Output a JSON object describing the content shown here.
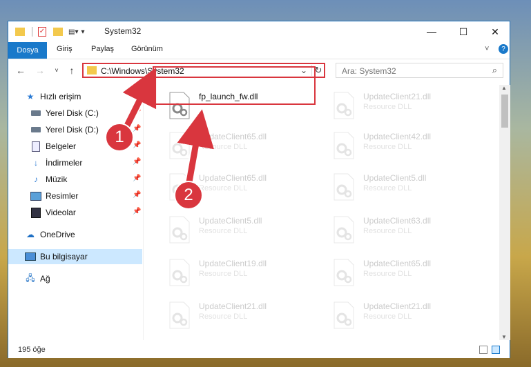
{
  "window": {
    "title": "System32"
  },
  "ribbon": {
    "tabs": [
      "Dosya",
      "Giriş",
      "Paylaş",
      "Görünüm"
    ]
  },
  "address": {
    "path": "C:\\Windows\\System32",
    "search_placeholder": "Ara: System32"
  },
  "sidebar": {
    "items": [
      {
        "label": "Hızlı erişim",
        "icon": "star-icon"
      },
      {
        "label": "Yerel Disk (C:)",
        "icon": "drive-icon"
      },
      {
        "label": "Yerel Disk (D:)",
        "icon": "drive-icon"
      },
      {
        "label": "Belgeler",
        "icon": "document-icon"
      },
      {
        "label": "İndirmeler",
        "icon": "download-icon"
      },
      {
        "label": "Müzik",
        "icon": "music-icon"
      },
      {
        "label": "Resimler",
        "icon": "picture-icon"
      },
      {
        "label": "Videolar",
        "icon": "video-icon"
      },
      {
        "label": "OneDrive",
        "icon": "cloud-icon"
      },
      {
        "label": "Bu bilgisayar",
        "icon": "computer-icon"
      },
      {
        "label": "Ağ",
        "icon": "network-icon"
      }
    ]
  },
  "files": [
    {
      "name": "fp_launch_fw.dll",
      "type": ""
    },
    {
      "name": "UpdateClient21.dll",
      "type": "Resource DLL"
    },
    {
      "name": "UpdateClient65.dll",
      "type": "Resource DLL"
    },
    {
      "name": "UpdateClient42.dll",
      "type": "Resource DLL"
    },
    {
      "name": "UpdateClient65.dll",
      "type": "Resource DLL"
    },
    {
      "name": "UpdateClient5.dll",
      "type": "Resource DLL"
    },
    {
      "name": "UpdateClient5.dll",
      "type": "Resource DLL"
    },
    {
      "name": "UpdateClient63.dll",
      "type": "Resource DLL"
    },
    {
      "name": "UpdateClient19.dll",
      "type": "Resource DLL"
    },
    {
      "name": "UpdateClient65.dll",
      "type": "Resource DLL"
    },
    {
      "name": "UpdateClient21.dll",
      "type": "Resource DLL"
    },
    {
      "name": "UpdateClient21.dll",
      "type": "Resource DLL"
    }
  ],
  "status": {
    "count": "195 öğe"
  },
  "callouts": [
    "1",
    "2"
  ],
  "colors": {
    "accent": "#1979ca",
    "highlight": "#d9363e",
    "selected": "#cce8ff"
  }
}
